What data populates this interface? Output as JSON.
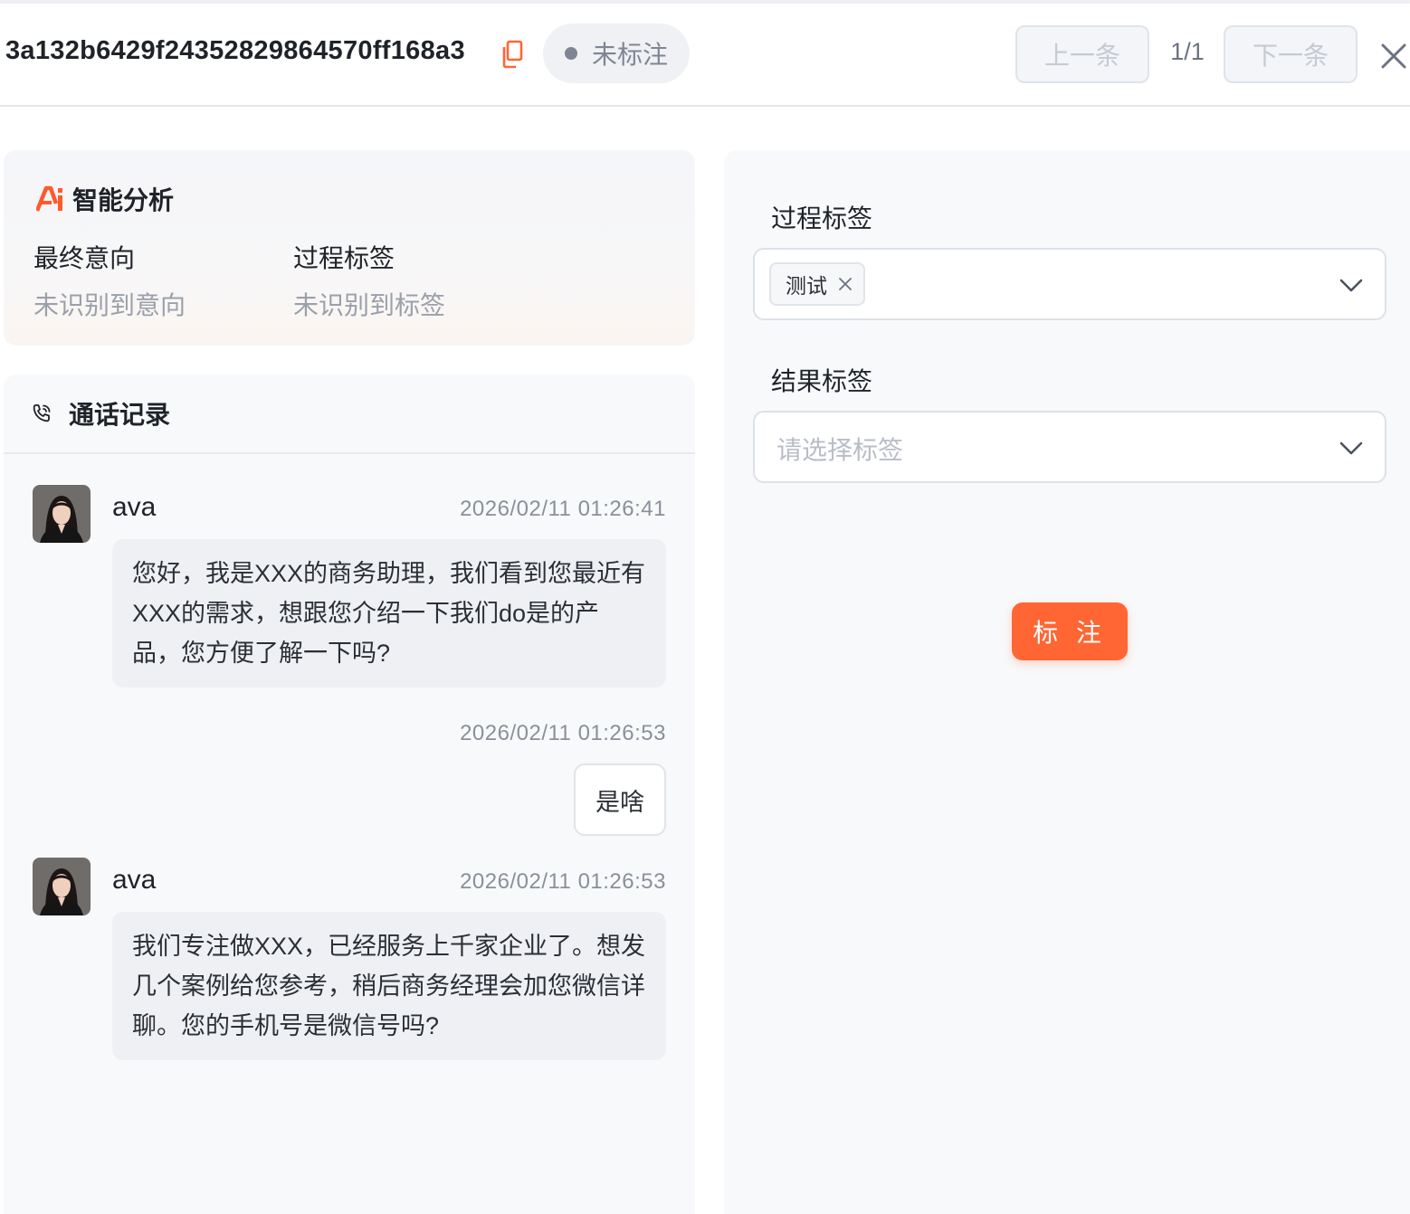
{
  "header": {
    "record_id": "3a132b6429f24352829864570ff168a3",
    "status": "未标注",
    "prev_label": "上一条",
    "page_indicator": "1/1",
    "next_label": "下一条"
  },
  "ai_analysis": {
    "title": "智能分析",
    "fields": [
      {
        "label": "最终意向",
        "value": "未识别到意向"
      },
      {
        "label": "过程标签",
        "value": "未识别到标签"
      }
    ]
  },
  "call_record": {
    "title": "通话记录",
    "messages": [
      {
        "speaker": "ava",
        "time": "2026/02/11 01:26:41",
        "text": "您好，我是XXX的商务助理，我们看到您最近有XXX的需求，想跟您介绍一下我们do是的产品，您方便了解一下吗?"
      },
      {
        "speaker": "",
        "time": "2026/02/11 01:26:53",
        "text": "是啥"
      },
      {
        "speaker": "ava",
        "time": "2026/02/11 01:26:53",
        "text": "我们专注做XXX，已经服务上千家企业了。想发几个案例给您参考，稍后商务经理会加您微信详聊。您的手机号是微信号吗?"
      }
    ]
  },
  "form": {
    "process_tag_label": "过程标签",
    "process_tags": [
      "测试"
    ],
    "result_tag_label": "结果标签",
    "result_tag_placeholder": "请选择标签",
    "submit_label": "标 注"
  },
  "colors": {
    "accent": "#ff6633",
    "muted_text": "#9aa0ab",
    "panel_bg": "#f8f9fb"
  }
}
